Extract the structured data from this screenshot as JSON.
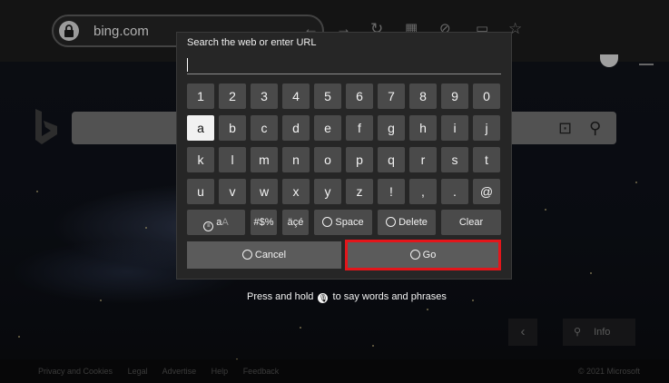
{
  "browser": {
    "url": "bing.com",
    "toolbar_icons": [
      "back-arrow-icon",
      "forward-arrow-icon",
      "reload-icon",
      "apps-grid-icon",
      "hide-icon",
      "tv-icon",
      "star-icon"
    ]
  },
  "bing_page": {
    "info_label": "Info",
    "footer_left": [
      "Privacy and Cookies",
      "Legal",
      "Advertise",
      "Help",
      "Feedback"
    ],
    "footer_right": "© 2021 Microsoft"
  },
  "keyboard": {
    "title": "Search the web or enter URL",
    "input_value": "",
    "rows": [
      [
        "1",
        "2",
        "3",
        "4",
        "5",
        "6",
        "7",
        "8",
        "9",
        "0"
      ],
      [
        "a",
        "b",
        "c",
        "d",
        "e",
        "f",
        "g",
        "h",
        "i",
        "j"
      ],
      [
        "k",
        "l",
        "m",
        "n",
        "o",
        "p",
        "q",
        "r",
        "s",
        "t"
      ],
      [
        "u",
        "v",
        "w",
        "x",
        "y",
        "z",
        "!",
        ",",
        ".",
        "@"
      ]
    ],
    "selected_key": "a",
    "mode_key": {
      "primary": "a",
      "secondary": "A"
    },
    "symbols_key": "#$%",
    "accents_key": "äçé",
    "space_label": "Space",
    "delete_label": "Delete",
    "clear_label": "Clear",
    "cancel_label": "Cancel",
    "go_label": "Go",
    "focused_button": "Go",
    "focus_color": "#e3161b"
  },
  "hint": {
    "before": "Press and hold",
    "after": "to say words and phrases"
  }
}
